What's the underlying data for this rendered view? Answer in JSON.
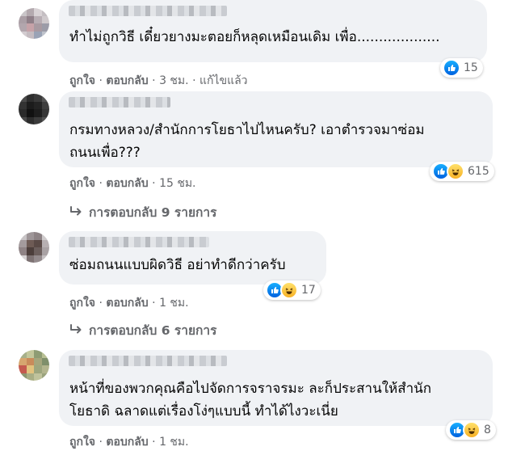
{
  "comments": [
    {
      "lines": [
        "ทำไม่ถูกวิธี เดี๋ยวยางมะตอยก็หลุดเหมือนเดิม เพื่อ..................."
      ],
      "reaction_count": "15",
      "like_label": "ถูกใจ",
      "reply_label": "ตอบกลับ",
      "time": "3 ชม.",
      "edited": "แก้ไขแล้ว"
    },
    {
      "lines": [
        "กรมทางหลวง/สำนักการโยธาไปไหนครับ? เอาตำรวจมาซ่อม",
        "ถนนเพื่อ???"
      ],
      "reaction_count": "615",
      "like_label": "ถูกใจ",
      "reply_label": "ตอบกลับ",
      "time": "15 ชม.",
      "replies_label": "การตอบกลับ 9 รายการ"
    },
    {
      "lines": [
        "ซ่อมถนนแบบผิดวิธี อย่าทำดีกว่าครับ"
      ],
      "reaction_count": "17",
      "like_label": "ถูกใจ",
      "reply_label": "ตอบกลับ",
      "time": "1 ชม.",
      "replies_label": "การตอบกลับ 6 รายการ"
    },
    {
      "lines": [
        "หน้าที่ของพวกคุณคือไปจัดการจราจรมะ ละก็ประสานให้สำนัก",
        "โยธาดิ ฉลาดแต่เรื่องโง่ๆแบบนี้ ทำได้ไงวะเนี่ย"
      ],
      "reaction_count": "8",
      "like_label": "ถูกใจ",
      "reply_label": "ตอบกลับ",
      "time": "1 ชม."
    }
  ],
  "separator": "·",
  "colors": {
    "bubble": "#f0f2f5",
    "meta": "#65676b",
    "like": "#1877f2",
    "haha": "#f7b125"
  }
}
